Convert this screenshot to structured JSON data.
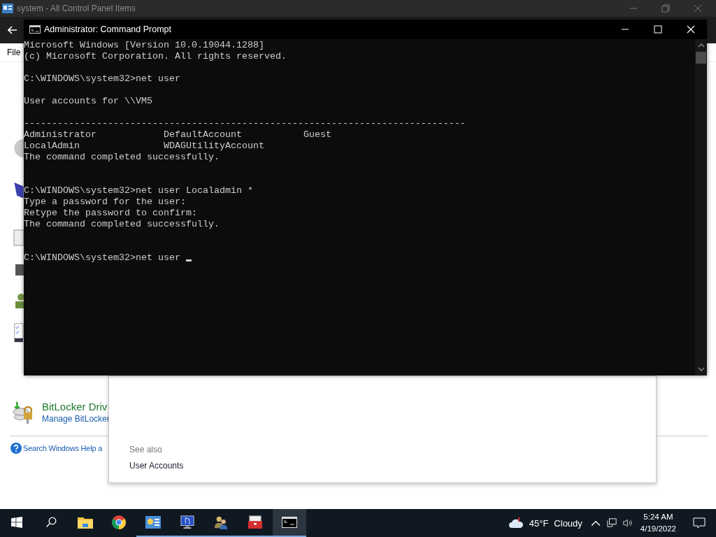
{
  "background_window": {
    "title": "system - All Control Panel Items",
    "menu": [
      "File"
    ],
    "items": [
      {
        "title": "BitLocker Driv",
        "link": "Manage BitLocker"
      }
    ],
    "help_link": "Search Windows Help a"
  },
  "popup": {
    "heading": "See also",
    "links": [
      "User Accounts"
    ]
  },
  "console_window": {
    "title": "Administrator: Command Prompt",
    "output": "Microsoft Windows [Version 10.0.19044.1288]\n(c) Microsoft Corporation. All rights reserved.\n\nC:\\WINDOWS\\system32>net user\n\nUser accounts for \\\\VM5\n\n-------------------------------------------------------------------------------\nAdministrator            DefaultAccount           Guest\nLocalAdmin               WDAGUtilityAccount\nThe command completed successfully.\n\n\nC:\\WINDOWS\\system32>net user Localadmin *\nType a password for the user:\nRetype the password to confirm:\nThe command completed successfully.\n\n\nC:\\WINDOWS\\system32>net user "
  },
  "taskbar": {
    "apps": [
      {
        "kind": "start",
        "running": false,
        "selected": false
      },
      {
        "kind": "search",
        "running": false,
        "selected": false
      },
      {
        "kind": "files",
        "running": false,
        "selected": false
      },
      {
        "kind": "browser",
        "running": false,
        "selected": false
      },
      {
        "kind": "panel",
        "running": true,
        "selected": false
      },
      {
        "kind": "monitor",
        "running": true,
        "selected": false
      },
      {
        "kind": "users",
        "running": true,
        "selected": false
      },
      {
        "kind": "toolbox",
        "running": true,
        "selected": false
      },
      {
        "kind": "console",
        "running": true,
        "selected": true
      }
    ],
    "weather": {
      "temperature": "45°F",
      "condition": "Cloudy"
    },
    "time": "5:24 AM",
    "date": "4/19/2022"
  }
}
